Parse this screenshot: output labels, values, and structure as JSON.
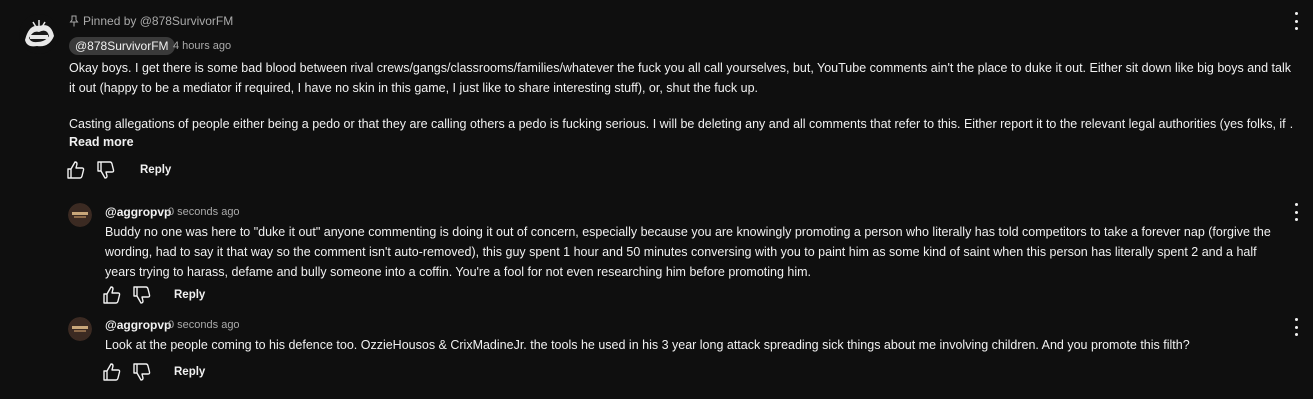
{
  "pinned_comment": {
    "pinned_label": "Pinned by @878SurvivorFM",
    "author": "@878SurvivorFM",
    "time": "4 hours ago",
    "paragraph1": "Okay boys. I get there is some bad blood between rival crews/gangs/classrooms/families/whatever the fuck you all call yourselves, but, YouTube comments ain't the place to duke it out. Either sit down like big boys and talk it out (happy to be a mediator if required, I have no skin in this game, I just like to share interesting stuff), or, shut the fuck up.",
    "paragraph2": "Casting allegations of people either being a pedo or that they are calling others a pedo is fucking serious. I will be deleting any and all comments that refer to this. Either report it to the relevant legal authorities (yes folks, if …",
    "read_more": "Read more",
    "reply_label": "Reply"
  },
  "replies": [
    {
      "author": "@aggropvp",
      "time": "0 seconds ago",
      "text": "Buddy no one was here to \"duke it out\" anyone commenting is doing it out of concern, especially because you are knowingly promoting a person who literally has told competitors to take a forever nap (forgive the wording, had to say it that way so the comment isn't auto-removed), this guy spent 1 hour and 50 minutes conversing with you to paint him as some kind of saint when this person has literally spent 2 and a half years trying to harass, defame and bully someone into a coffin. You're a fool for not even researching him before promoting him.",
      "reply_label": "Reply"
    },
    {
      "author": "@aggropvp",
      "time": "0 seconds ago",
      "text": "Look at the people coming to his defence too. OzzieHousos & CrixMadineJr. the tools he used in his 3 year long attack spreading sick things about me involving children. And you promote this filth?",
      "reply_label": "Reply"
    }
  ],
  "colors": {
    "background": "#0f0f0f",
    "text": "#f1f1f1",
    "secondary_text": "#aaaaaa",
    "chip": "#3a3a3a"
  },
  "icons": [
    "pin-icon",
    "like-icon",
    "dislike-icon",
    "more-vert-icon"
  ]
}
